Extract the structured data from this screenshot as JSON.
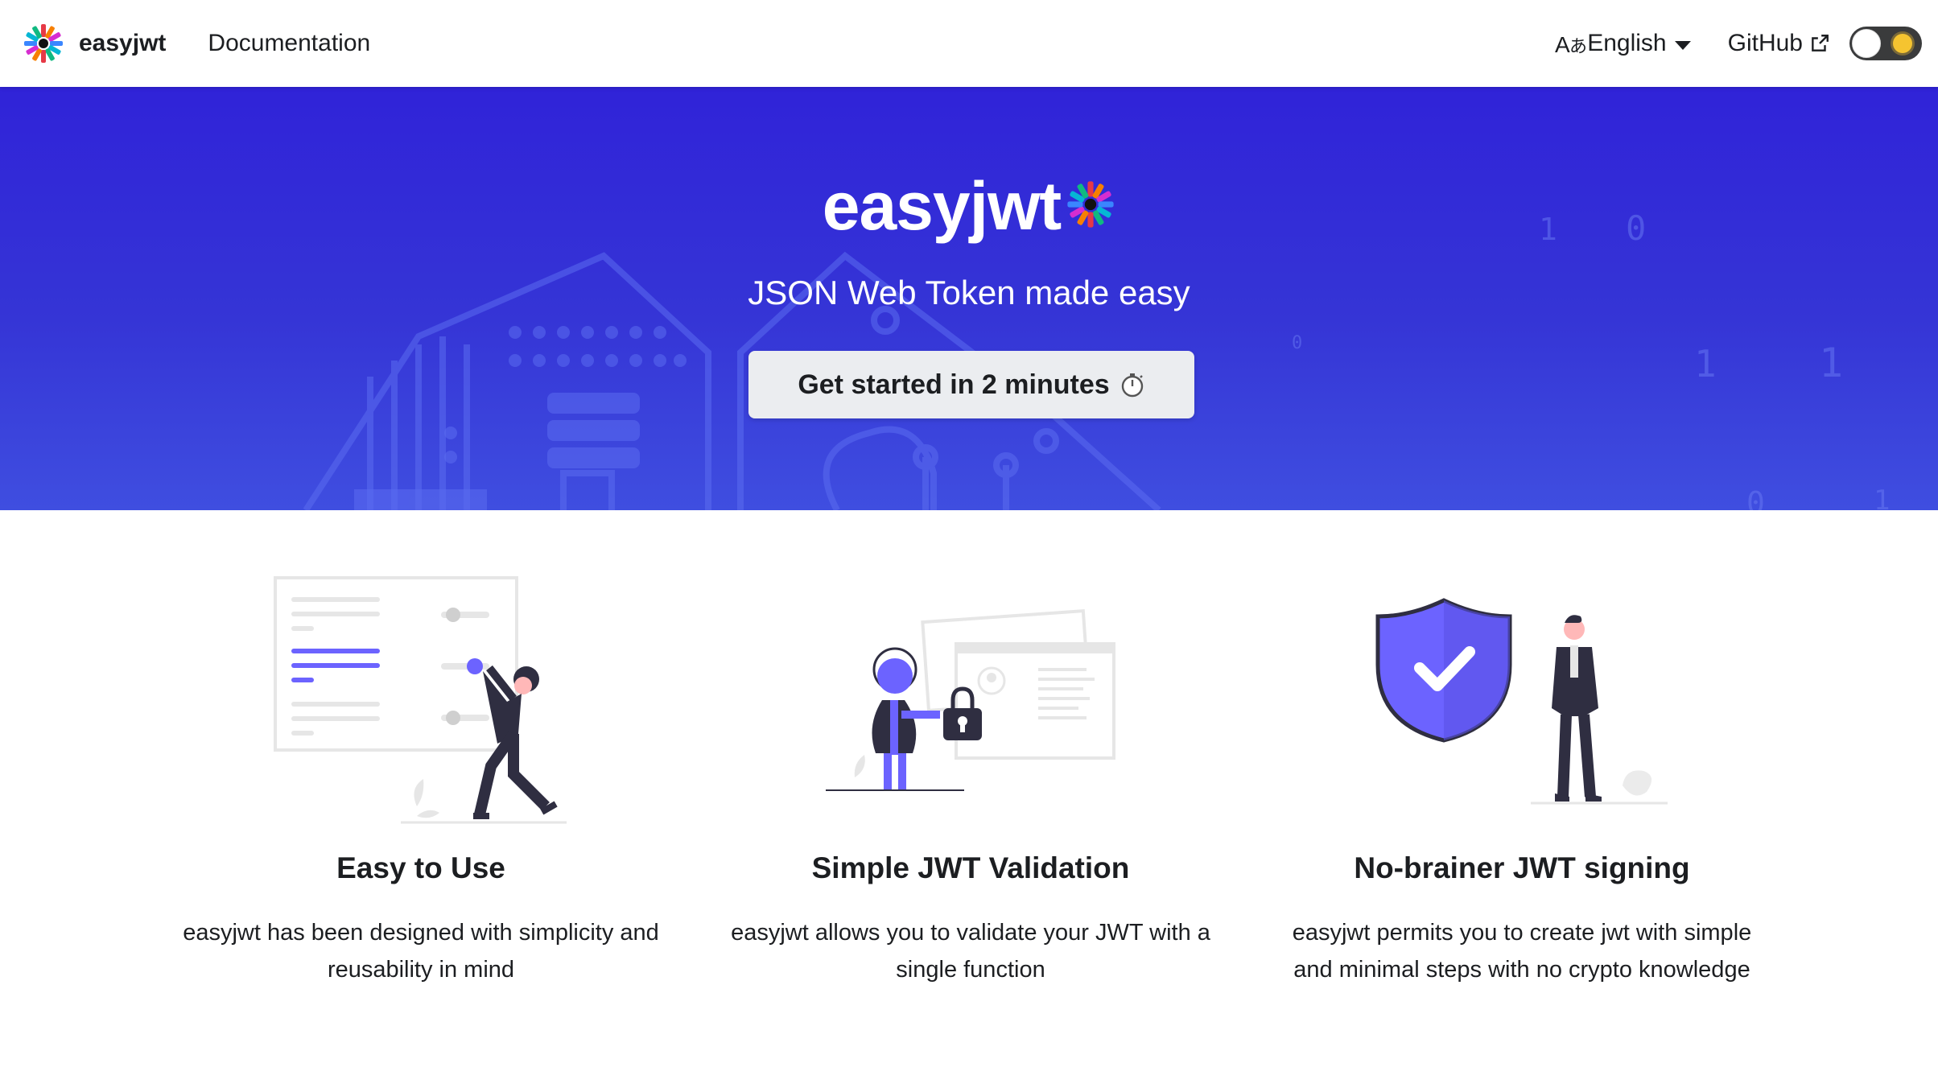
{
  "navbar": {
    "brand_name": "easyjwt",
    "links": [
      "Documentation"
    ],
    "language_label": "English",
    "language_icon": "translate-icon",
    "github_label": "GitHub",
    "github_icon": "external-link-icon",
    "theme_toggle": "dark-mode-toggle"
  },
  "hero": {
    "title": "easyjwt",
    "subtitle": "JSON Web Token made easy",
    "cta_label": "Get started in 2 minutes",
    "cta_icon": "stopwatch-icon",
    "bg_binary": [
      "1",
      "0",
      "0",
      "1",
      "1",
      "0",
      "1"
    ],
    "colors": {
      "gradient_top": "#3023d8",
      "gradient_bottom": "#3f4ee0"
    }
  },
  "features": [
    {
      "title": "Easy to Use",
      "description": "easyjwt has been designed with simplicity and reusability in mind",
      "illustration": "person-adjusting-settings-illustration"
    },
    {
      "title": "Simple JWT Validation",
      "description": "easyjwt allows you to validate your JWT with a single function",
      "illustration": "person-with-lock-illustration"
    },
    {
      "title": "No-brainer JWT signing",
      "description": "easyjwt permits you to create jwt with simple and minimal steps with no crypto knowledge",
      "illustration": "shield-check-illustration"
    }
  ],
  "colors": {
    "accent": "#6c63ff",
    "dark_figure": "#2f2e41",
    "text": "#1c1e21"
  }
}
